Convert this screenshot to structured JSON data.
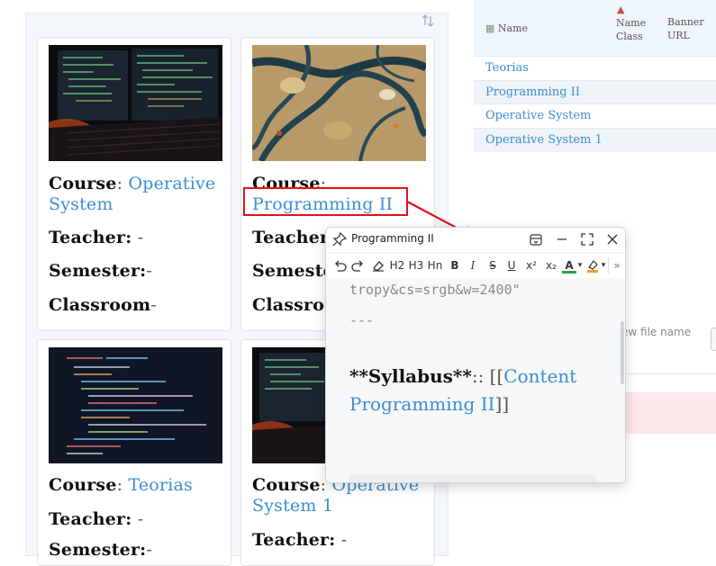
{
  "cards": [
    {
      "course_label": "Course",
      "course_sep": ":",
      "course_value": "Operative System",
      "teacher_label": "Teacher:",
      "teacher_value": "-",
      "semester_label": "Semester:",
      "semester_value": "-",
      "classroom_label": "Classroom",
      "classroom_value": "-"
    },
    {
      "course_label": "Course",
      "course_sep": ":",
      "course_value": "Programming II",
      "teacher_label": "Teacher:",
      "semester_label": "Semeste",
      "classroom_label": "Classroo"
    },
    {
      "course_label": "Course",
      "course_sep": ":",
      "course_value": "Teorias",
      "teacher_label": "Teacher:",
      "teacher_value": "-",
      "semester_label": "Semester:",
      "semester_value": "-"
    },
    {
      "course_label": "Course",
      "course_sep": ":",
      "course_value": "Operative System 1",
      "teacher_label": "Teacher:",
      "teacher_value": "-"
    }
  ],
  "table": {
    "headers": {
      "name": "Name",
      "name_class_line1": "Name",
      "name_class_line2": "Class",
      "banner_line1": "Banner",
      "banner_line2": "URL"
    },
    "rows": [
      "Teorias",
      "Programming II",
      "Operative System",
      "Operative System 1"
    ]
  },
  "filename_placeholder": "ew file name",
  "popup": {
    "title": "Programming II",
    "toolbar": {
      "h2": "H2",
      "h3": "H3",
      "hn": "Hn",
      "bold": "B",
      "italic": "I",
      "strike": "S",
      "underline": "U",
      "sup": "x²",
      "sub": "x₂",
      "font_color": "A"
    },
    "editor": {
      "line1": "tropy&cs=srgb&w=2400\"",
      "line2": "---",
      "syllabus_key": "**Syllabus**",
      "syllabus_sep": ":: [[",
      "syllabus_link": "Content Programming II",
      "syllabus_end": "]]"
    }
  },
  "colors": {
    "link": "#3b8ed3",
    "annotation": "#e3101a",
    "header_bg": "#eef5fb"
  }
}
